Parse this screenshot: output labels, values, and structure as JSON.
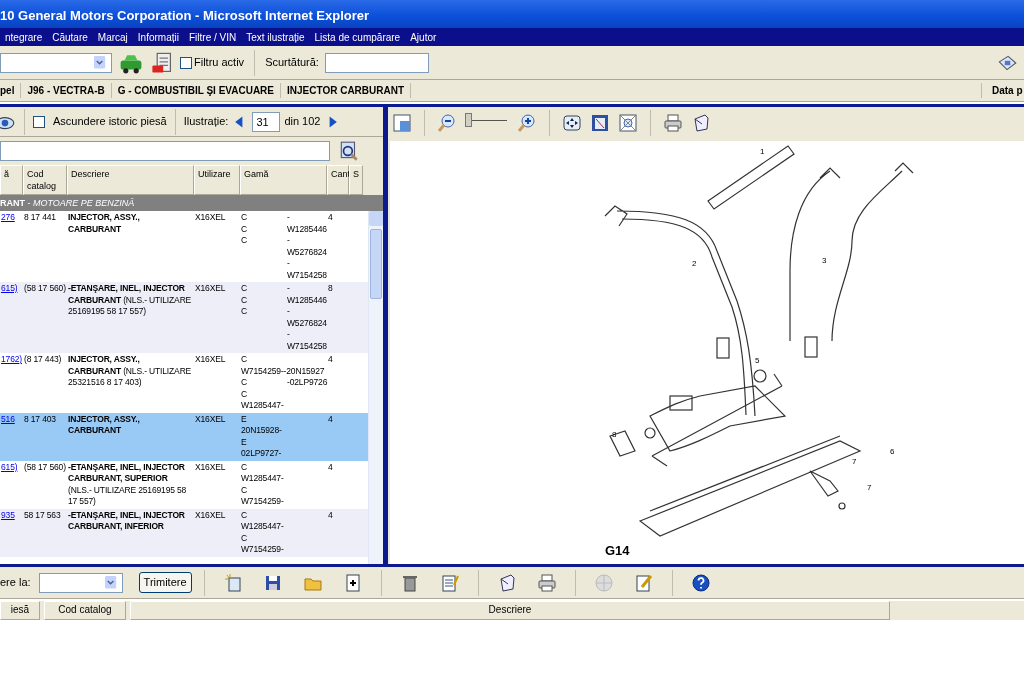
{
  "window": {
    "title": "10 General Motors Corporation - Microsoft Internet Explorer"
  },
  "menu": [
    "ntegrare",
    "Căutare",
    "Marcaj",
    "Informații",
    "Filtre / VIN",
    "Text ilustrație",
    "Lista de cumpărare",
    "Ajutor"
  ],
  "toolbar": {
    "filter_label": "Filtru activ",
    "filter_checked": false,
    "shortcut_label": "Scurtătură:"
  },
  "breadcrumb": [
    "pel",
    "J96 - VECTRA-B",
    "G - COMBUSTIBIL ŞI EVACUARE",
    "INJECTOR CARBURANT"
  ],
  "date_label": "Data p",
  "parts_panel": {
    "hide_history_label": "Ascundere istoric piesă",
    "hide_history_checked": false,
    "illustration_label": "Ilustrație:",
    "illustration_value": "31",
    "illustration_total": "din 102",
    "columns": [
      "ă",
      "Cod catalog",
      "Descriere",
      "Utilizare",
      "Gamă",
      "Cant",
      "S"
    ],
    "group": "**RANT** - *MOTOARE PE BENZINĂ*",
    "rows": [
      {
        "part": "276",
        "catalog": "8 17 441",
        "description": "**INJECTOR, ASSY., CARBURANT**",
        "usage": "X16XEL",
        "range": [
          {
            "left": "C",
            "right": "-"
          },
          {
            "left": "C",
            "right": "W1285446"
          },
          {
            "left": "C",
            "right": "-"
          },
          {
            "right": "W5276824"
          },
          {
            "right": "-"
          },
          {
            "right": "W7154258"
          }
        ],
        "qty": "4",
        "selected": false
      },
      {
        "part": "615)",
        "catalog": "(58 17 560)",
        "description": "**-ETANŞARE, INEL, INJECTOR CARBURANT** (NLS.- UTILIZARE 25169195 58 17 557)",
        "usage": "X16XEL",
        "range": [
          {
            "left": "C",
            "right": "-"
          },
          {
            "left": "C",
            "right": "W1285446"
          },
          {
            "left": "C",
            "right": "-"
          },
          {
            "right": "W5276824"
          },
          {
            "right": "-"
          },
          {
            "right": "W7154258"
          }
        ],
        "qty": "8",
        "selected": false
      },
      {
        "part": "1762)",
        "catalog": "(8 17 443)",
        "description": "**INJECTOR, ASSY., CARBURANT** (NLS.- UTILIZARE 25321516 8 17 403)",
        "usage": "X16XEL",
        "range": [
          {
            "left": "C"
          },
          {
            "left": "W7154259--20N15927"
          },
          {
            "left": "C",
            "right": "-02LP9726"
          },
          {
            "left": "C"
          },
          {
            "left": "W1285447-"
          }
        ],
        "qty": "4",
        "selected": false
      },
      {
        "part": "516",
        "catalog": "8 17 403",
        "description": "**INJECTOR, ASSY., CARBURANT**",
        "usage": "X16XEL",
        "range": [
          {
            "left": "E"
          },
          {
            "left": "20N15928-"
          },
          {
            "left": "E"
          },
          {
            "left": "02LP9727-"
          }
        ],
        "qty": "4",
        "selected": true
      },
      {
        "part": "615)",
        "catalog": "(58 17 560)",
        "description": "**-ETANŞARE, INEL, INJECTOR CARBURANT, SUPERIOR** (NLS.- UTILIZARE 25169195 58 17 557)",
        "usage": "X16XEL",
        "range": [
          {
            "left": "C"
          },
          {
            "left": "W1285447-"
          },
          {
            "left": "C"
          },
          {
            "left": "W7154259-"
          }
        ],
        "qty": "4",
        "selected": false
      },
      {
        "part": "935",
        "catalog": "58 17 563",
        "description": "**-ETANŞARE, INEL, INJECTOR CARBURANT, INFERIOR**",
        "usage": "X16XEL",
        "range": [
          {
            "left": "C"
          },
          {
            "left": "W1285447-"
          },
          {
            "left": "C"
          },
          {
            "left": "W7154259-"
          }
        ],
        "qty": "4",
        "selected": false
      }
    ]
  },
  "illustration": {
    "zoom": {
      "level": 0
    },
    "callouts": [
      "1",
      "2",
      "3",
      "5",
      "8",
      "7",
      "6",
      "7"
    ],
    "figure_label": "G14"
  },
  "bottom_bar": {
    "send_label": "ere la:",
    "send_button": "Trimitere",
    "columns": [
      "iesă",
      "Cod catalog",
      "Descriere"
    ]
  }
}
